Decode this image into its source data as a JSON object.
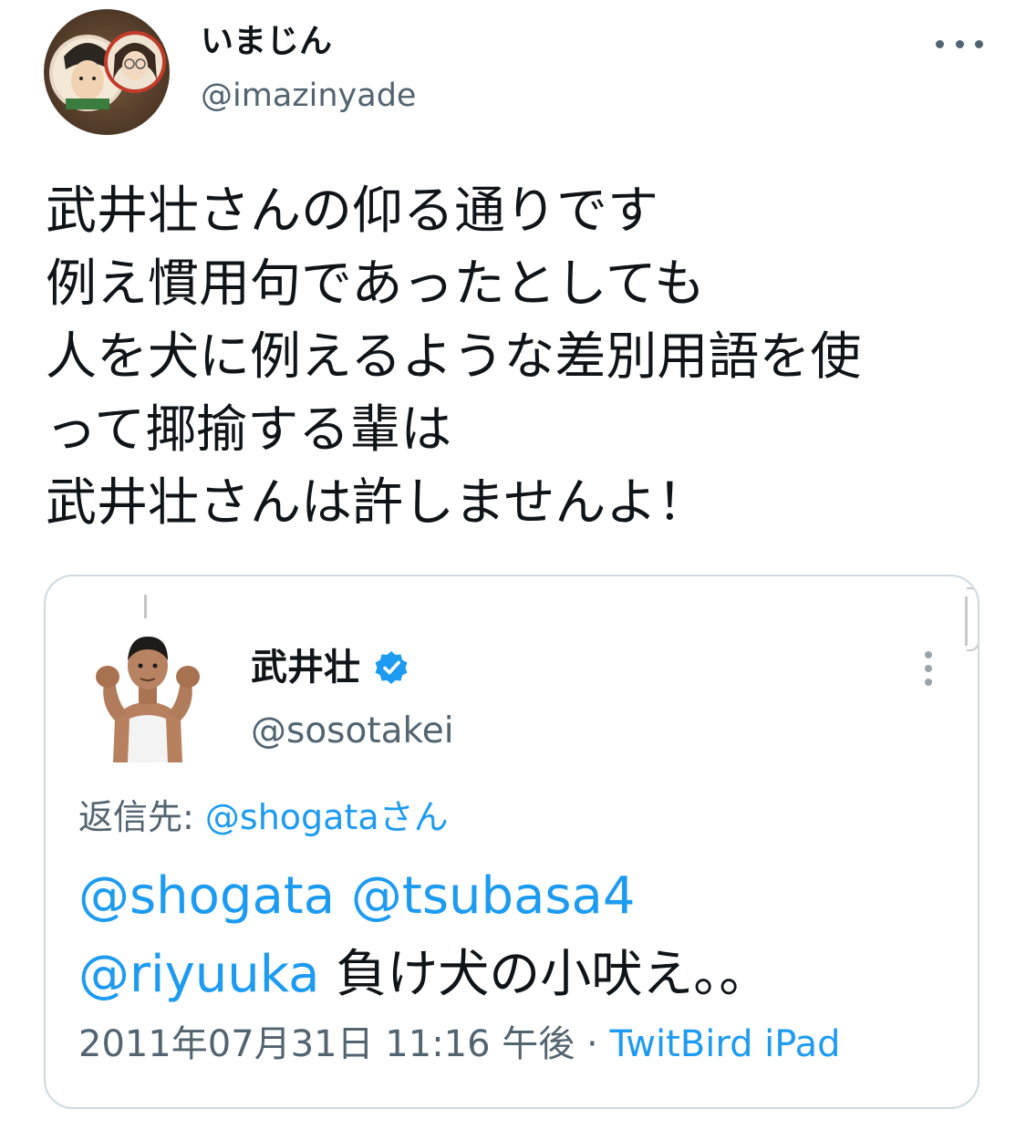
{
  "author": {
    "display_name": "いまじん",
    "handle": "@imazinyade",
    "avatar_icon": "avatar-badges-photo"
  },
  "more_icon": "more-horizontal-icon",
  "tweet": {
    "lines": [
      "武井壮さんの仰る通りです",
      "例え慣用句であったとしても",
      "人を犬に例えるような差別用語を使",
      "って揶揄する輩は",
      "武井壮さんは許しませんよ！"
    ]
  },
  "quoted": {
    "display_name": "武井壮",
    "verified_icon": "verified-badge-icon",
    "verified_color": "#1d9bf0",
    "handle": "@sosotakei",
    "reply_prefix": "返信先: ",
    "reply_to": "@shogataさん",
    "mentions": [
      "@shogata",
      "@tsubasa4",
      "@riyuuka"
    ],
    "text": "負け犬の小吠え。。",
    "timestamp": "2011年07月31日 11:16 午後",
    "separator": " · ",
    "source": "TwitBird iPad",
    "more_icon": "more-vertical-icon"
  },
  "colors": {
    "text_primary": "#0f1419",
    "text_secondary": "#536471",
    "link": "#1d9bf0",
    "card_border": "#cfd9de"
  }
}
